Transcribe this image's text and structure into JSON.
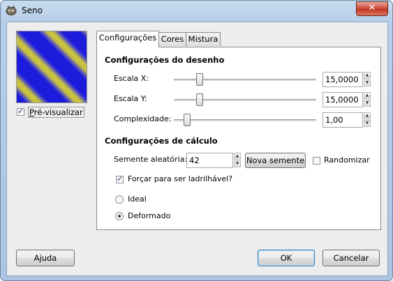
{
  "window": {
    "title": "Seno",
    "close_glyph": "✕",
    "app_icon": "gimp-icon"
  },
  "preview": {
    "checkbox_label": "Pré-visualizar",
    "checked": true,
    "colors": [
      "#1d1bdc",
      "#c9c23e"
    ]
  },
  "tabs": [
    {
      "label": "Configurações",
      "active": true
    },
    {
      "label": "Cores",
      "active": false
    },
    {
      "label": "Mistura",
      "active": false
    }
  ],
  "drawing": {
    "heading": "Configurações do desenho",
    "scale_x": {
      "label": "Escala X:",
      "value": "15,0000"
    },
    "scale_y": {
      "label": "Escala Y:",
      "value": "15,0000"
    },
    "complexity": {
      "label": "Complexidade:",
      "value": "1,00"
    }
  },
  "calc": {
    "heading": "Configurações de cálculo",
    "seed_label": "Semente aleatória:",
    "seed_value": "42",
    "new_seed": "Nova semente",
    "randomize": "Randomizar",
    "randomize_checked": false,
    "tileable": "Forçar para ser ladrilhável?",
    "tileable_checked": true,
    "ideal": "Ideal",
    "distorted": "Deformado",
    "selected_mode": "Deformado"
  },
  "buttons": {
    "help": "Ajuda",
    "ok": "OK",
    "cancel": "Cancelar"
  },
  "colors": {
    "accent": "#3c7fb1",
    "close": "#c2341f"
  }
}
